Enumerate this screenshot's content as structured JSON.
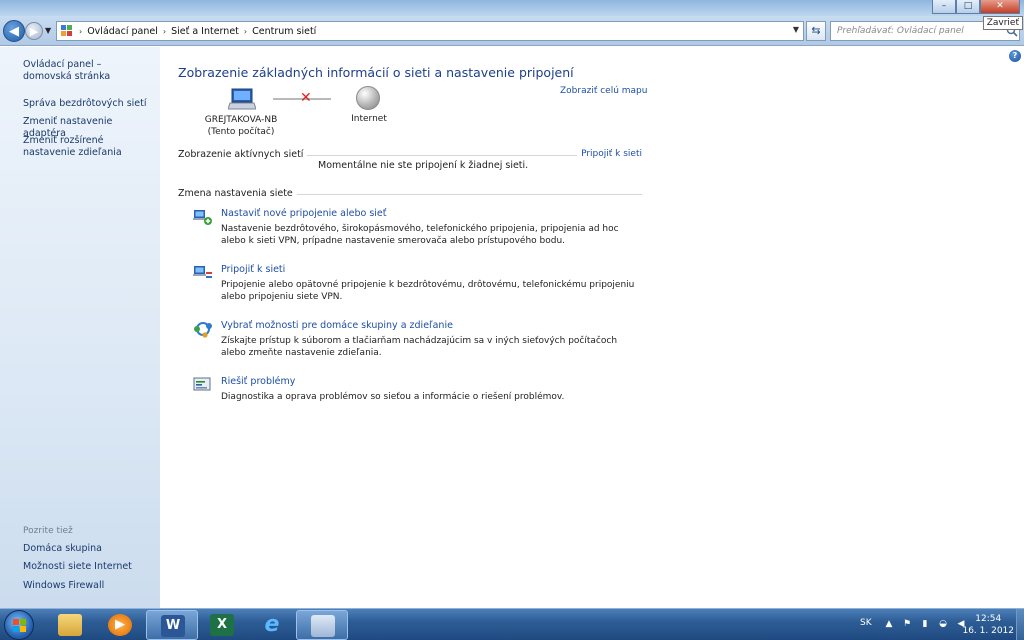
{
  "window": {
    "title": "",
    "close_tooltip": "Zavrieť",
    "buttons": {
      "minimize": "–",
      "maximize": "□",
      "close": "✕"
    }
  },
  "addressbar": {
    "breadcrumbs": [
      "Ovládací panel",
      "Sieť a Internet",
      "Centrum sietí"
    ],
    "search_placeholder": "Prehľadávať: Ovládací panel"
  },
  "sidebar": {
    "links": [
      {
        "label": "Ovládací panel – domovská stránka"
      },
      {
        "label": "Správa bezdrôtových sietí"
      },
      {
        "label": "Zmeniť nastavenie adaptéra"
      },
      {
        "label": "Zmeniť rozšírené nastavenie zdieľania"
      }
    ],
    "see_also_title": "Pozrite tiež",
    "see_also": [
      {
        "label": "Domáca skupina"
      },
      {
        "label": "Možnosti siete Internet"
      },
      {
        "label": "Windows Firewall"
      }
    ]
  },
  "main": {
    "heading": "Zobrazenie základných informácií o sieti a nastavenie pripojení",
    "full_map_link": "Zobraziť celú mapu",
    "computer_name": "GREJTAKOVA-NB",
    "computer_sub": "(Tento počítač)",
    "internet_label": "Internet",
    "active_networks_title": "Zobrazenie aktívnych sietí",
    "connect_link": "Pripojiť k sieti",
    "no_network_msg": "Momentálne nie ste pripojení k žiadnej sieti.",
    "change_settings_title": "Zmena nastavenia siete",
    "tasks": [
      {
        "title": "Nastaviť nové pripojenie alebo sieť",
        "desc": "Nastavenie bezdrôtového, širokopásmového, telefonického pripojenia, pripojenia ad hoc alebo k sieti VPN, prípadne nastavenie smerovača alebo prístupového bodu."
      },
      {
        "title": "Pripojiť k sieti",
        "desc": "Pripojenie alebo opätovné pripojenie k bezdrôtovému, drôtovému, telefonickému pripojeniu alebo pripojeniu siete VPN."
      },
      {
        "title": "Vybrať možnosti pre domáce skupiny a zdieľanie",
        "desc": "Získajte prístup k súborom a tlačiarňam nachádzajúcim sa v iných sieťových počítačoch alebo zmeňte nastavenie zdieľania."
      },
      {
        "title": "Riešiť problémy",
        "desc": "Diagnostika a oprava problémov so sieťou a informácie o riešení problémov."
      }
    ]
  },
  "taskbar": {
    "language": "SK",
    "time": "12:54",
    "date": "16. 1. 2012",
    "apps": [
      {
        "icon": "explorer-folder-icon",
        "glyph": ""
      },
      {
        "icon": "media-player-icon",
        "glyph": "▶"
      },
      {
        "icon": "word-icon",
        "glyph": "W"
      },
      {
        "icon": "excel-icon",
        "glyph": "X"
      },
      {
        "icon": "internet-explorer-icon",
        "glyph": "e"
      },
      {
        "icon": "control-panel-icon",
        "glyph": ""
      }
    ],
    "colors": {
      "word": "#2b5797",
      "excel": "#1e7145",
      "ie": "#2a8ad4"
    }
  }
}
